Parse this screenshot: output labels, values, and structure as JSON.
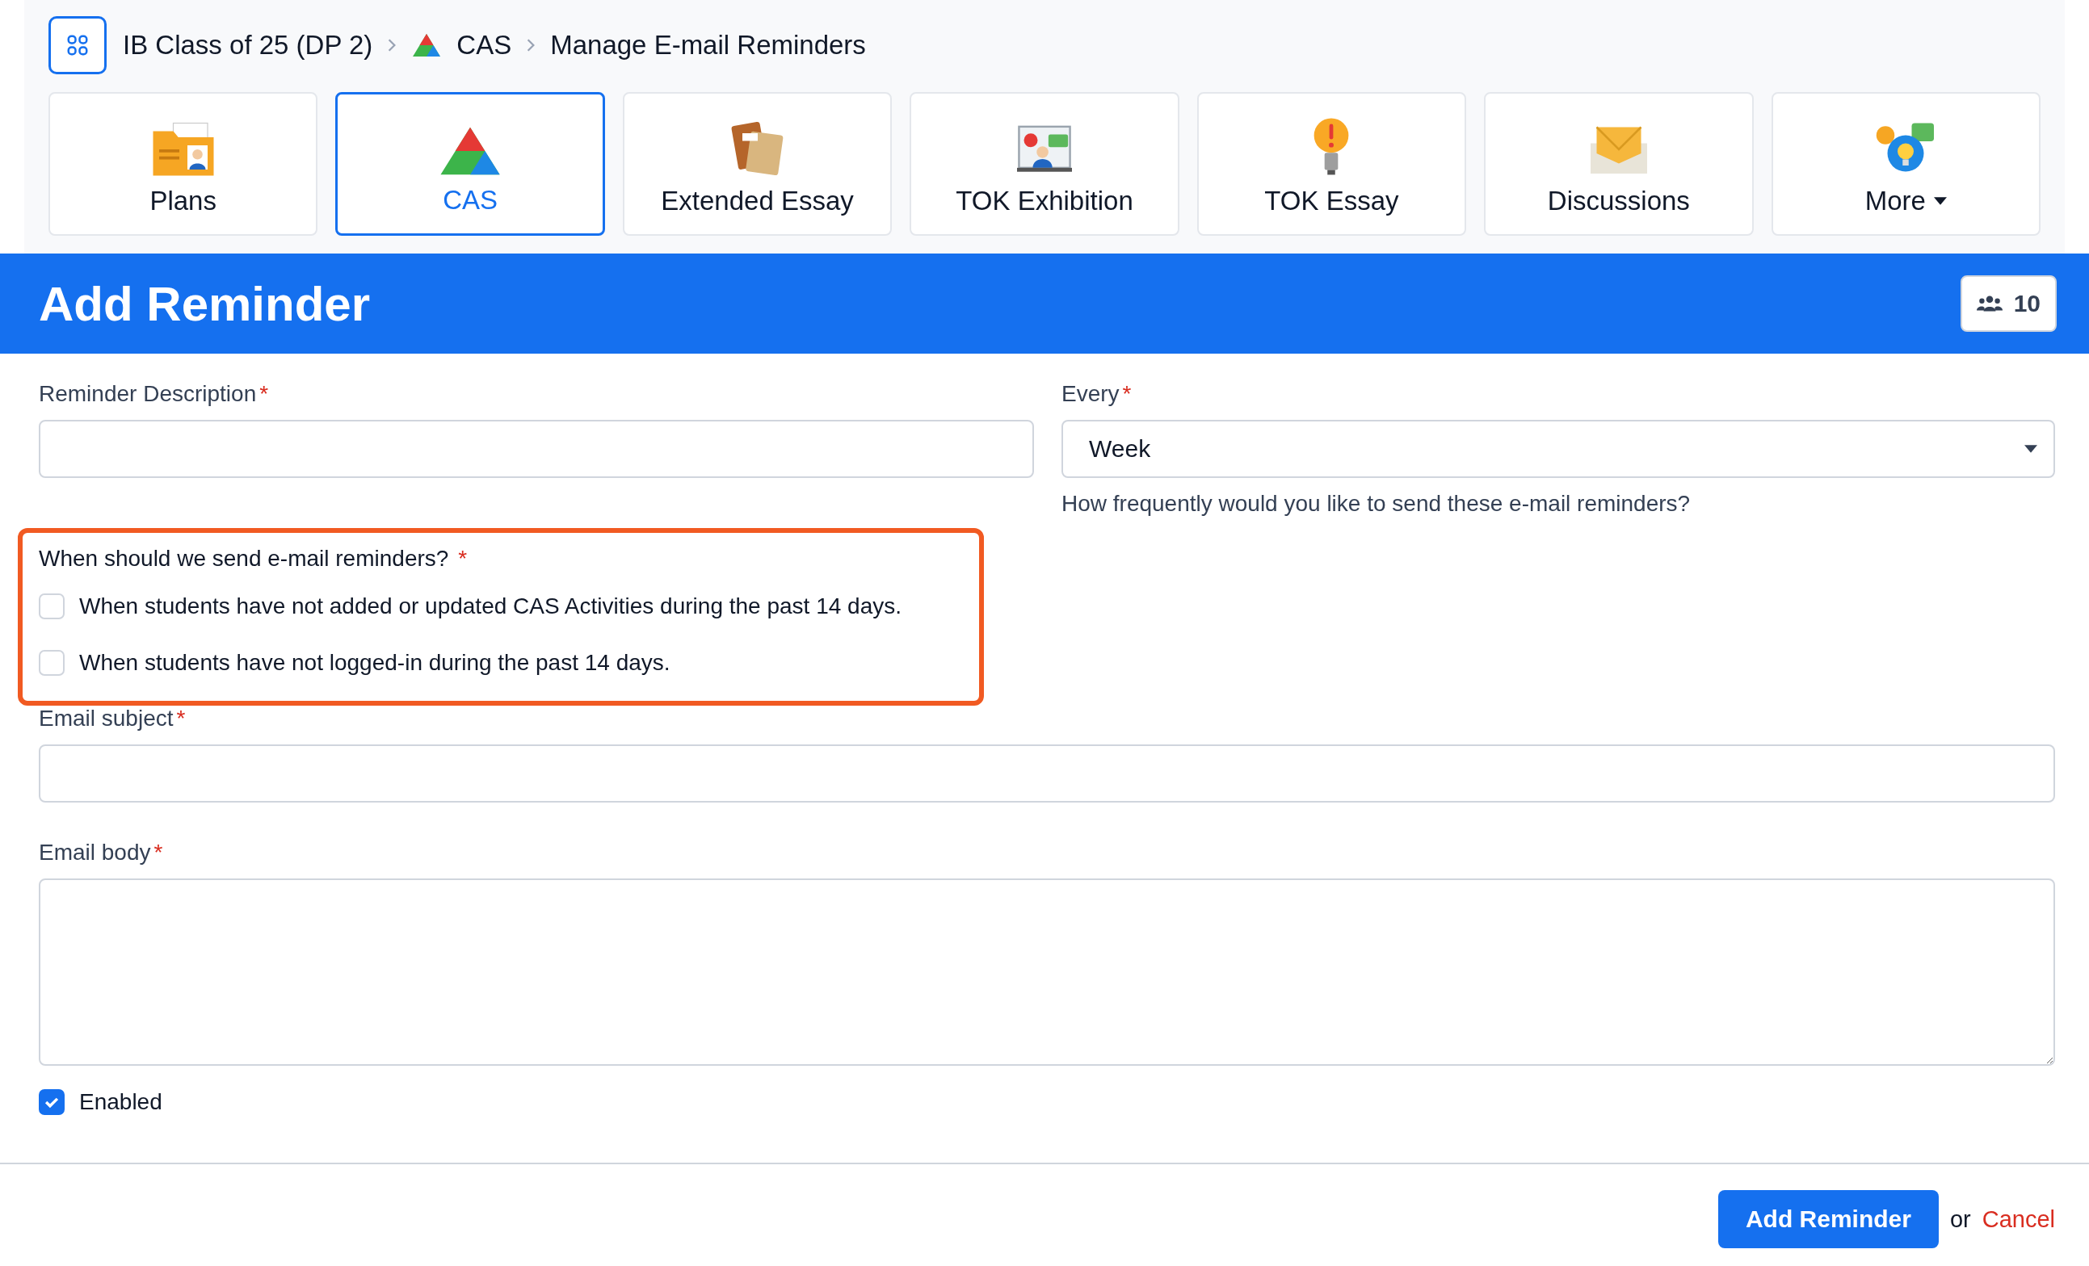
{
  "breadcrumb": [
    {
      "kind": "text",
      "text": "IB Class of 25 (DP 2)"
    },
    {
      "kind": "cas",
      "text": "CAS"
    },
    {
      "kind": "text",
      "text": "Manage E-mail Reminders"
    }
  ],
  "tabs": [
    {
      "kind": "folder",
      "label": "Plans",
      "selected": false,
      "dropdown": false
    },
    {
      "kind": "cas",
      "label": "CAS",
      "selected": true,
      "dropdown": false
    },
    {
      "kind": "books",
      "label": "Extended Essay",
      "selected": false,
      "dropdown": false
    },
    {
      "kind": "board",
      "label": "TOK Exhibition",
      "selected": false,
      "dropdown": false
    },
    {
      "kind": "bulb",
      "label": "TOK Essay",
      "selected": false,
      "dropdown": false
    },
    {
      "kind": "envelope",
      "label": "Discussions",
      "selected": false,
      "dropdown": false
    },
    {
      "kind": "chat",
      "label": "More",
      "selected": false,
      "dropdown": true
    }
  ],
  "header": {
    "title": "Add Reminder",
    "members": "10"
  },
  "form": {
    "description": {
      "label": "Reminder Description",
      "marker": "*"
    },
    "every": {
      "label": "Every",
      "marker": "*",
      "value": "Week",
      "help": "How frequently would you like to send these e-mail reminders?"
    },
    "when": {
      "label": "When should we send e-mail reminders?",
      "marker": "*",
      "highlighted": true,
      "options": [
        {
          "label": "When students have not added or updated CAS Activities during the past 14 days.",
          "checked": false
        },
        {
          "label": "When students have not logged-in during the past 14 days.",
          "checked": false
        }
      ]
    },
    "subject": {
      "label": "Email subject",
      "marker": "*"
    },
    "body": {
      "label": "Email body",
      "marker": "*"
    },
    "enabled": {
      "label": "Enabled",
      "checked": true
    }
  },
  "footer": {
    "submit": "Add Reminder",
    "or": "or",
    "cancel": "Cancel"
  }
}
